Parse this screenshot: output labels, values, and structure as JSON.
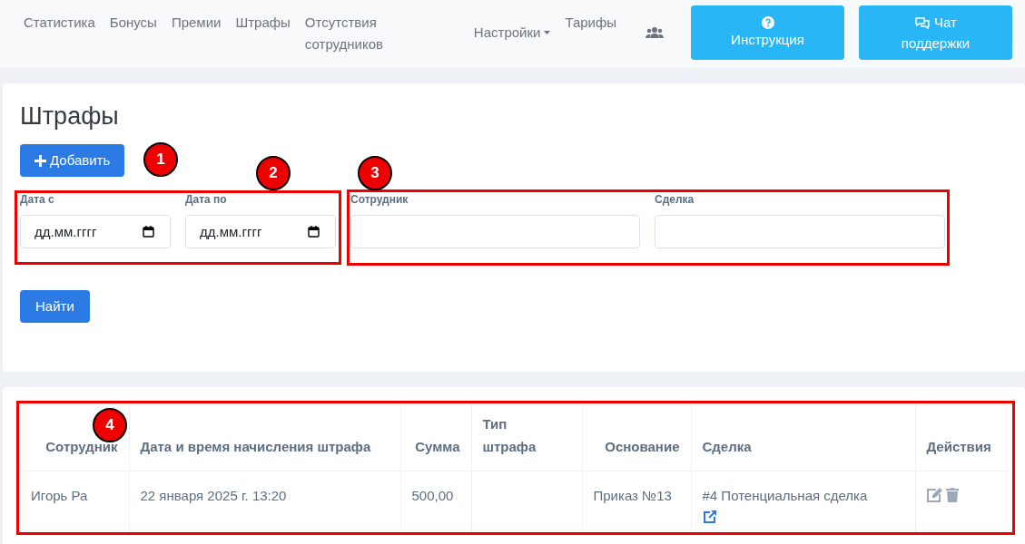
{
  "nav": {
    "links": [
      {
        "kind": "link",
        "label": "Статистика"
      },
      {
        "kind": "link",
        "label": "Бонусы"
      },
      {
        "kind": "link",
        "label": "Премии"
      },
      {
        "kind": "link",
        "label": "Штрафы"
      },
      {
        "kind": "link",
        "label": "Отсутствия сотрудников"
      },
      {
        "kind": "dropdown",
        "label": "Настройки"
      },
      {
        "kind": "link",
        "label": "Тарифы"
      },
      {
        "kind": "icon"
      }
    ],
    "buttons": [
      {
        "kind": "help",
        "label": "Инструкция"
      },
      {
        "kind": "chat",
        "label": "Чат поддержки"
      }
    ]
  },
  "filters": {
    "title": "Штрафы",
    "add_button": "Добавить",
    "fields": [
      {
        "kind": "date",
        "label": "Дата с",
        "placeholder": "дд.мм.гггг"
      },
      {
        "kind": "date",
        "label": "Дата по",
        "placeholder": "дд.мм.гггг"
      },
      {
        "kind": "text",
        "label": "Сотрудник"
      },
      {
        "kind": "text",
        "label": "Сделка"
      }
    ],
    "search_button": "Найти"
  },
  "table": {
    "columns": [
      "Сотрудник",
      "Дата и время начисления штрафа",
      "Сумма",
      "Тип штрафа",
      "Основание",
      "Сделка",
      "Действия"
    ],
    "rows": [
      {
        "employee": "Игорь Ра",
        "date": "22 января 2025 г. 13:20",
        "amount": "500,00",
        "basis": "Приказ №13",
        "deal": "#4 Потенциальная сделка"
      }
    ]
  },
  "annotations": [
    "1",
    "2",
    "3",
    "4"
  ]
}
